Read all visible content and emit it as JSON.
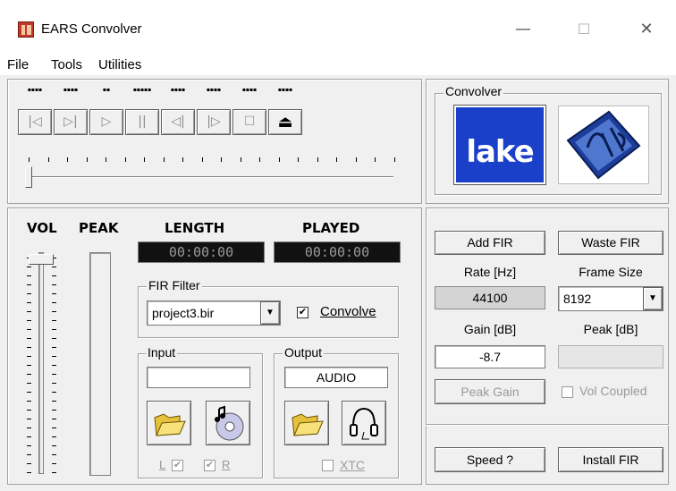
{
  "window": {
    "title": "EARS Convolver",
    "minimize_glyph": "—",
    "maximize_glyph": "☐",
    "close_glyph": "✕"
  },
  "menu": [
    "File",
    "Tools",
    "Utilities"
  ],
  "transport": {
    "buttons": [
      {
        "name": "skip-back",
        "glyph": "|◁"
      },
      {
        "name": "skip-forward",
        "glyph": "▷|"
      },
      {
        "name": "play",
        "glyph": "▷"
      },
      {
        "name": "pause",
        "glyph": "||"
      },
      {
        "name": "rewind",
        "glyph": "◁|"
      },
      {
        "name": "fast-forward",
        "glyph": "|▷"
      },
      {
        "name": "stop",
        "glyph": "☐"
      },
      {
        "name": "eject",
        "glyph": "⏏"
      }
    ],
    "position": 0
  },
  "convolver": {
    "group_label": "Convolver",
    "lake_logo": "lake",
    "ears_logo": "EARS"
  },
  "meters": {
    "vol_label": "VOL",
    "peak_label": "PEAK",
    "length_label": "LENGTH",
    "played_label": "PLAYED",
    "length_value": "00:00:00",
    "played_value": "00:00:00"
  },
  "fir_filter": {
    "group_label": "FIR Filter",
    "selected": "project3.bir",
    "convolve_label": "Convolve",
    "convolve_checked": true
  },
  "input": {
    "group_label": "Input",
    "value": "",
    "l_label": "L",
    "r_label": "R"
  },
  "output": {
    "group_label": "Output",
    "value": "AUDIO",
    "xtc_label": "XTC"
  },
  "controls": {
    "add_fir": "Add FIR",
    "waste_fir": "Waste FIR",
    "rate_label": "Rate [Hz]",
    "rate_value": "44100",
    "frame_size_label": "Frame Size",
    "frame_size_value": "8192",
    "gain_label": "Gain [dB]",
    "gain_value": "-8.7",
    "peak_label": "Peak [dB]",
    "peak_value": "",
    "peak_gain": "Peak Gain",
    "vol_coupled": "Vol Coupled",
    "speed": "Speed ?",
    "install_fir": "Install FIR"
  },
  "colors": {
    "lake_bg": "#1a3fc9",
    "lcd_bg": "#111111"
  }
}
